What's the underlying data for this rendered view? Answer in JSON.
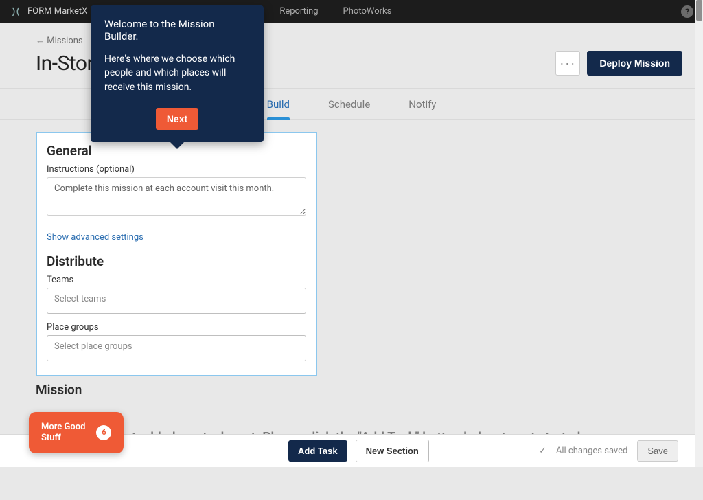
{
  "topbar": {
    "brand": "FORM MarketX",
    "nav": {
      "reporting": "Reporting",
      "photoworks": "PhotoWorks"
    }
  },
  "header": {
    "back": "← Missions",
    "title": "In-Stor",
    "more": "···",
    "deploy": "Deploy Mission"
  },
  "tabs": {
    "build": "Build",
    "schedule": "Schedule",
    "notify": "Notify"
  },
  "form": {
    "general_h": "General",
    "instructions_label": "Instructions (optional)",
    "instructions_value": "Complete this mission at each account visit this month.",
    "advanced_link": "Show advanced settings",
    "distribute_h": "Distribute",
    "teams_label": "Teams",
    "teams_placeholder": "Select teams",
    "places_label": "Place groups",
    "places_placeholder": "Select place groups"
  },
  "mission": {
    "heading": "Mission",
    "empty": "t added any tasks yet. Please click the \"Add Task\" button below to get started."
  },
  "bottom": {
    "add_task": "Add Task",
    "new_section": "New Section",
    "status": "All changes saved",
    "save": "Save"
  },
  "tip": {
    "title": "Welcome to the Mission Builder.",
    "body": "Here's where we choose which people and which places will receive this mission.",
    "next": "Next"
  },
  "pill": {
    "text": "More Good\nStuff",
    "count": "6"
  }
}
